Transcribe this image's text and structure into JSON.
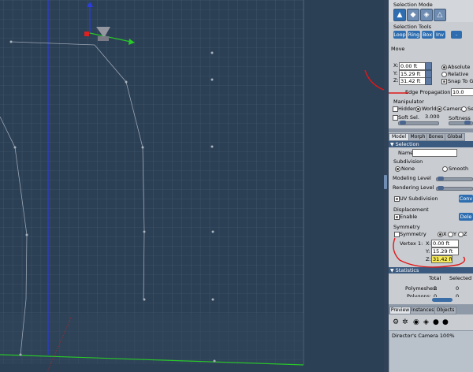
{
  "selection_mode": {
    "label": "Selection Mode",
    "icons": [
      "vertex-mode-icon",
      "edge-mode-icon",
      "face-mode-icon",
      "object-mode-icon"
    ]
  },
  "selection_tools": {
    "label": "Selection Tools",
    "buttons": [
      "Loop",
      "Ring",
      "Box",
      "Inv",
      "-"
    ]
  },
  "move": {
    "label": "Move",
    "x_label": "X:",
    "x": "0.00 ft",
    "y_label": "Y:",
    "y": "15.29 ft",
    "z_label": "Z:",
    "z": "31.42 ft",
    "absolute": "Absolute",
    "relative": "Relative",
    "snap": "Snap To Grid",
    "edge_propagation_label": "Edge Propagation",
    "edge_propagation_value": "10.0"
  },
  "manipulator": {
    "label": "Manipulator",
    "hidden": "Hidden",
    "world": "World",
    "camera": "Camera",
    "screen": "Se",
    "soft_sel": "Soft Sel.",
    "soft_sel_value": "3.000",
    "softness": "Softness"
  },
  "tabs": [
    "Model",
    "Morph",
    "Bones",
    "Global"
  ],
  "selection_header": "Selection",
  "name_label": "Name",
  "subdivision": {
    "label": "Subdivision",
    "none": "None",
    "smooth": "Smooth",
    "modeling_level": "Modeling Level",
    "rendering_level": "Rendering Level",
    "uv_subdivision": "UV Subdivision",
    "convert_button": "Conv"
  },
  "displacement": {
    "label": "Displacement",
    "enable": "Enable",
    "button": "Dele"
  },
  "symmetry": {
    "label": "Symmetry",
    "checkbox": "Symmetry",
    "axes": [
      "X",
      "Y",
      "Z"
    ],
    "vertex_label": "Vertex 1:",
    "x_label": "X:",
    "x": "0.00 ft",
    "y_label": "Y:",
    "y": "15.29 ft",
    "z_label": "Z:",
    "z": "31.42 ft"
  },
  "statistics": {
    "header": "Statistics",
    "col_total": "Total",
    "col_selected": "Selected",
    "rows": [
      {
        "label": "Polymeshes:",
        "total": "3",
        "selected": "0"
      },
      {
        "label": "Polygons:",
        "total": "0",
        "selected": "0"
      }
    ]
  },
  "bottom_tabs": [
    "Preview",
    "Instances",
    "Objects"
  ],
  "preview_caption": "Director's Camera 100%",
  "colors": {
    "viewport_bg": "#2b3f55",
    "grid": "#4f6277",
    "panel_bg": "#c9ccd1",
    "header": "#3b5a80",
    "accent_blue": "#2e6eb0",
    "annotation_red": "#e01818",
    "highlight": "#f5e95a"
  }
}
